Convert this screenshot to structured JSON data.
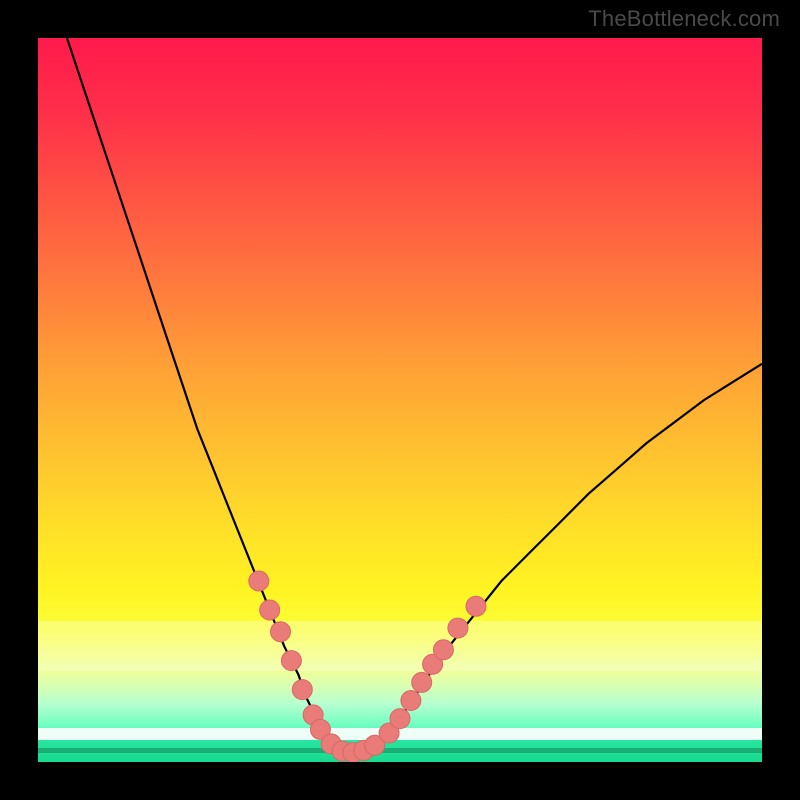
{
  "watermark": "TheBottleneck.com",
  "colors": {
    "frame": "#000000",
    "curve": "#000000",
    "marker_fill": "#e97b79",
    "marker_stroke": "#db6765"
  },
  "chart_data": {
    "type": "line",
    "title": "",
    "xlabel": "",
    "ylabel": "",
    "xlim": [
      0,
      100
    ],
    "ylim": [
      0,
      100
    ],
    "grid": false,
    "legend": false,
    "series": [
      {
        "name": "bottleneck-curve",
        "x": [
          4,
          6,
          8,
          10,
          12,
          14,
          16,
          18,
          20,
          22,
          24,
          26,
          28,
          30,
          32,
          34,
          36,
          37,
          38,
          39,
          40,
          41,
          42,
          43,
          44,
          45,
          46,
          48,
          50,
          52,
          54,
          56,
          60,
          64,
          68,
          72,
          76,
          80,
          84,
          88,
          92,
          96,
          100
        ],
        "y": [
          100,
          94,
          88,
          82,
          76,
          70,
          64,
          58,
          52,
          46,
          41,
          36,
          31,
          26,
          21,
          16,
          12,
          9,
          7,
          5,
          3,
          2,
          1.5,
          1.2,
          1.2,
          1.5,
          2,
          3.5,
          6,
          9,
          12,
          15,
          20,
          25,
          29,
          33,
          37,
          40.5,
          44,
          47,
          50,
          52.5,
          55
        ]
      }
    ],
    "markers": {
      "name": "valley-points",
      "xy": [
        [
          30.5,
          25
        ],
        [
          32,
          21
        ],
        [
          33.5,
          18
        ],
        [
          35,
          14
        ],
        [
          36.5,
          10
        ],
        [
          38,
          6.5
        ],
        [
          39,
          4.5
        ],
        [
          40.5,
          2.5
        ],
        [
          42,
          1.5
        ],
        [
          43.5,
          1.3
        ],
        [
          45,
          1.6
        ],
        [
          46.5,
          2.3
        ],
        [
          48.5,
          4
        ],
        [
          50,
          6
        ],
        [
          51.5,
          8.5
        ],
        [
          53,
          11
        ],
        [
          54.5,
          13.5
        ],
        [
          56,
          15.5
        ],
        [
          58,
          18.5
        ],
        [
          60.5,
          21.5
        ]
      ],
      "radius": 10
    }
  }
}
